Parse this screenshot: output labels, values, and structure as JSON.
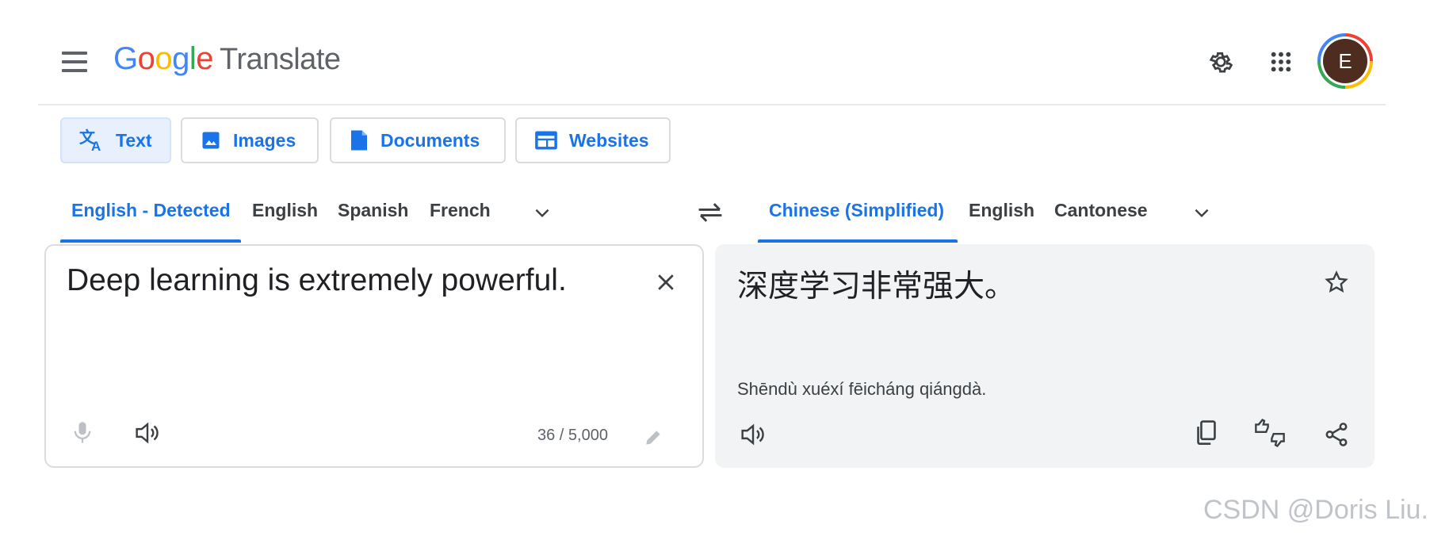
{
  "header": {
    "menu_icon": "hamburger-menu-icon",
    "logo_letters": [
      "G",
      "o",
      "o",
      "g",
      "l",
      "e"
    ],
    "product_name": "Translate",
    "settings_icon": "gear-icon",
    "apps_icon": "apps-grid-icon",
    "avatar_initial": "E"
  },
  "mode_tabs": [
    {
      "label": "Text",
      "icon": "translate-icon",
      "active": true
    },
    {
      "label": "Images",
      "icon": "image-icon",
      "active": false
    },
    {
      "label": "Documents",
      "icon": "document-icon",
      "active": false
    },
    {
      "label": "Websites",
      "icon": "website-icon",
      "active": false
    }
  ],
  "source_languages": {
    "items": [
      {
        "label": "English - Detected",
        "active": true
      },
      {
        "label": "English",
        "active": false
      },
      {
        "label": "Spanish",
        "active": false
      },
      {
        "label": "French",
        "active": false
      }
    ],
    "more_icon": "chevron-down-icon"
  },
  "swap_icon": "swap-languages-icon",
  "target_languages": {
    "items": [
      {
        "label": "Chinese (Simplified)",
        "active": true
      },
      {
        "label": "English",
        "active": false
      },
      {
        "label": "Cantonese",
        "active": false
      }
    ],
    "more_icon": "chevron-down-icon"
  },
  "source": {
    "text": "Deep learning is extremely powerful.",
    "char_count": "36 / 5,000",
    "icons": [
      "close-icon",
      "microphone-icon",
      "speaker-icon",
      "pencil-icon"
    ]
  },
  "target": {
    "text": "深度学习非常强大。",
    "romanization": "Shēndù xuéxí fēicháng qiángdà.",
    "icons": [
      "star-icon",
      "speaker-icon",
      "copy-icon",
      "feedback-thumbs-icon",
      "share-icon"
    ]
  },
  "watermark": "CSDN @Doris Liu.",
  "colors": {
    "accent": "#1a73e8",
    "active_tab_bg": "#e8f0fe",
    "target_panel_bg": "#f1f3f4",
    "avatar_bg": "#4e2d20"
  }
}
